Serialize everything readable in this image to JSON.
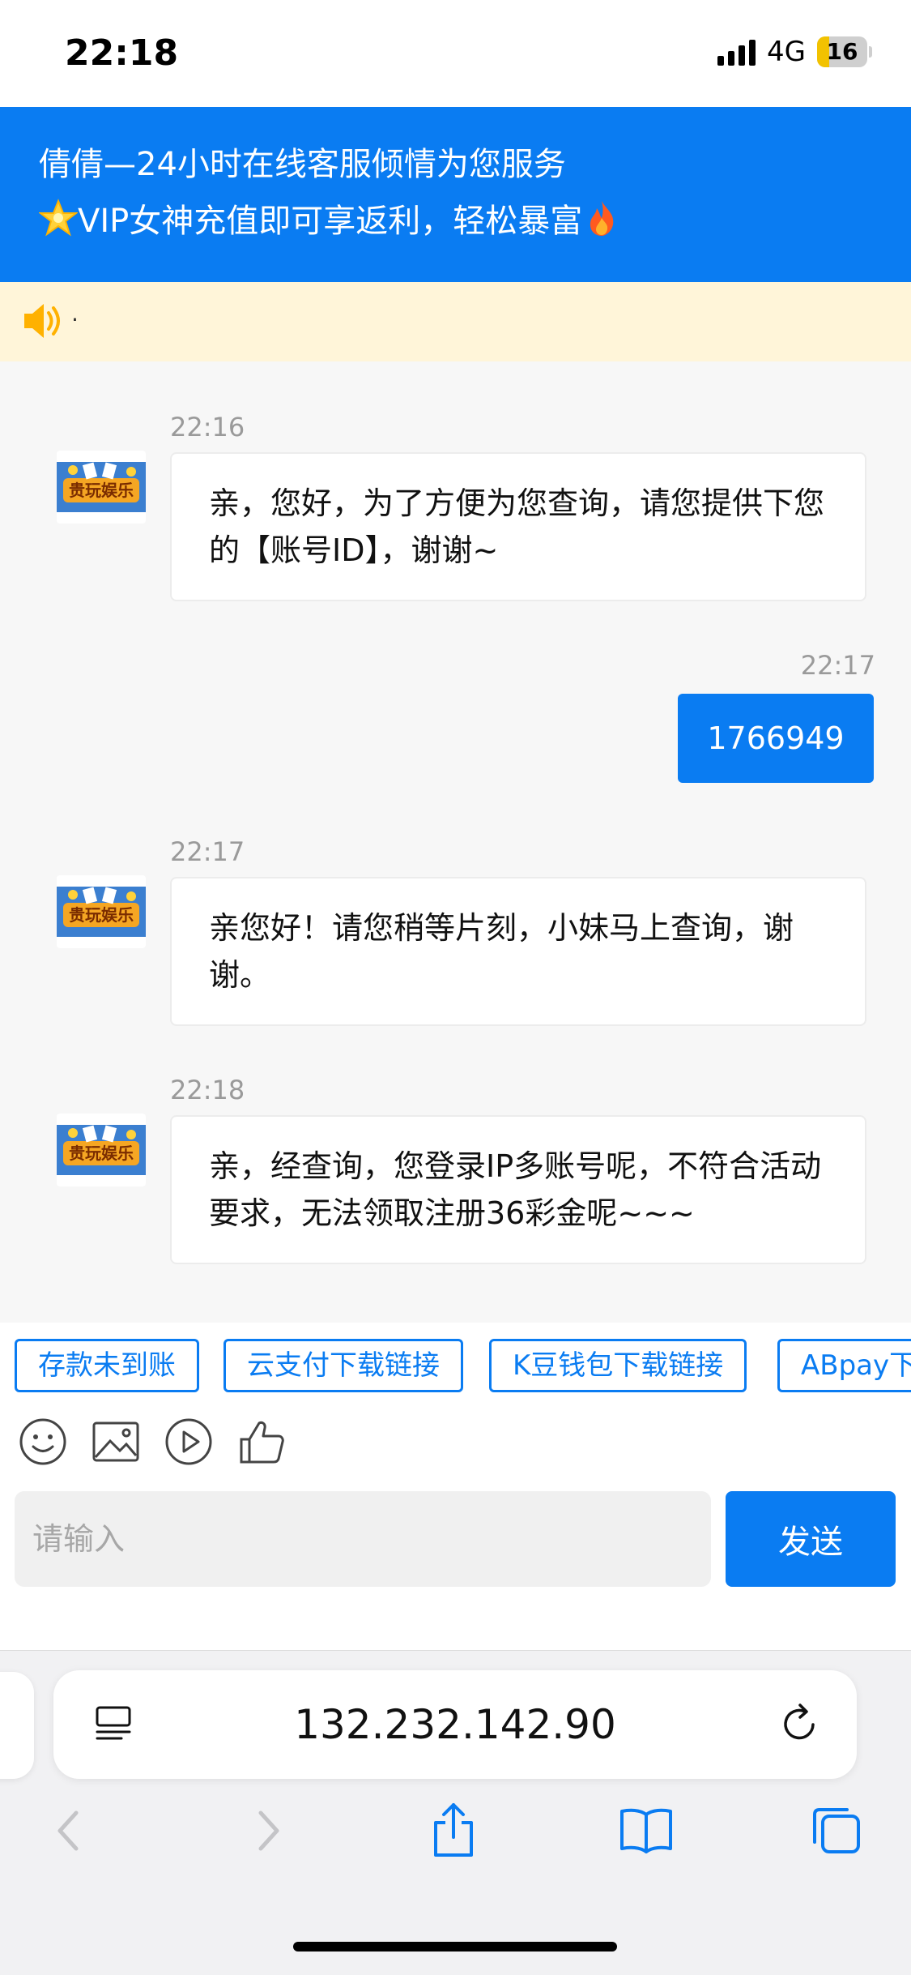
{
  "status_bar": {
    "time": "22:18",
    "network": "4G",
    "battery": "16"
  },
  "header": {
    "line1": "倩倩—24小时在线客服倾情为您服务",
    "line2": "VIP女神充值即可享返利，轻松暴富"
  },
  "notice": {
    "text": "·"
  },
  "messages": [
    {
      "time": "22:16",
      "side": "left",
      "text": "亲，您好，为了方便为您查询，请您提供下您的【账号ID】，谢谢~"
    },
    {
      "time": "22:17",
      "side": "right",
      "text": "1766949"
    },
    {
      "time": "22:17",
      "side": "left",
      "text": "亲您好！请您稍等片刻，小妹马上查询，谢谢。"
    },
    {
      "time": "22:18",
      "side": "left",
      "text": "亲，经查询，您登录IP多账号呢，不符合活动要求，无法领取注册36彩金呢~~~"
    }
  ],
  "quick_replies": [
    "存款未到账",
    "云支付下载链接",
    "K豆钱包下载链接",
    "ABpay下载链接"
  ],
  "input": {
    "placeholder": "请输入"
  },
  "send_label": "发送",
  "browser": {
    "url": "132.232.142.90"
  },
  "colors": {
    "primary": "#0a7cf2",
    "notice_bg": "#fff5d9",
    "chat_bg": "#f7f7f7"
  }
}
